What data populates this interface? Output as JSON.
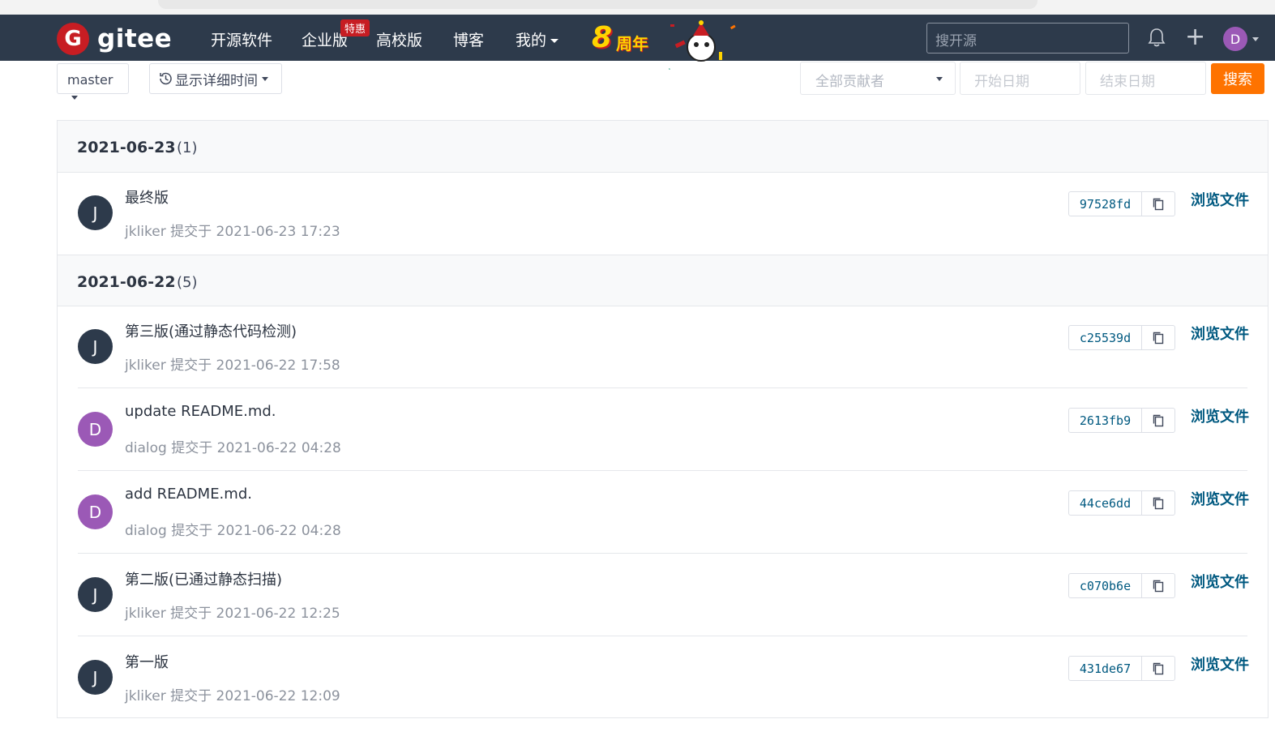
{
  "navbar": {
    "logo_letter": "G",
    "brand": "gitee",
    "items": [
      "开源软件",
      "企业版",
      "高校版",
      "博客"
    ],
    "mine": "我的",
    "badge": "特惠",
    "anniversary_num": "8",
    "anniversary_text": "周年",
    "search_placeholder": "搜开源",
    "user_initial": "D"
  },
  "filters": {
    "branch": "master",
    "time_toggle": "显示详细时间",
    "contributors": "全部贡献者",
    "start_date": "开始日期",
    "end_date": "结束日期",
    "search_btn": "搜索"
  },
  "commit_groups": [
    {
      "date": "2021-06-23",
      "count": "(1)",
      "commits": [
        {
          "initial": "J",
          "message": "最终版",
          "meta": "jkliker 提交于 2021-06-23 17:23",
          "sha": "97528fd",
          "browse": "浏览文件"
        }
      ]
    },
    {
      "date": "2021-06-22",
      "count": "(5)",
      "commits": [
        {
          "initial": "J",
          "message": "第三版(通过静态代码检测)",
          "meta": "jkliker 提交于 2021-06-22 17:58",
          "sha": "c25539d",
          "browse": "浏览文件"
        },
        {
          "initial": "D",
          "message": "update README.md.",
          "meta": "dialog 提交于 2021-06-22 04:28",
          "sha": "2613fb9",
          "browse": "浏览文件"
        },
        {
          "initial": "D",
          "message": "add README.md.",
          "meta": "dialog 提交于 2021-06-22 04:28",
          "sha": "44ce6dd",
          "browse": "浏览文件"
        },
        {
          "initial": "J",
          "message": "第二版(已通过静态扫描)",
          "meta": "jkliker 提交于 2021-06-22 12:25",
          "sha": "c070b6e",
          "browse": "浏览文件"
        },
        {
          "initial": "J",
          "message": "第一版",
          "meta": "jkliker 提交于 2021-06-22 12:09",
          "sha": "431de67",
          "browse": "浏览文件"
        }
      ]
    }
  ],
  "colors": {
    "navbar": "#2d3a4b",
    "brand_red": "#c71d23",
    "search_orange": "#fe7300",
    "link_blue": "#005980",
    "avatar_j": "#2d3a4b",
    "avatar_d": "#9b59b6"
  }
}
